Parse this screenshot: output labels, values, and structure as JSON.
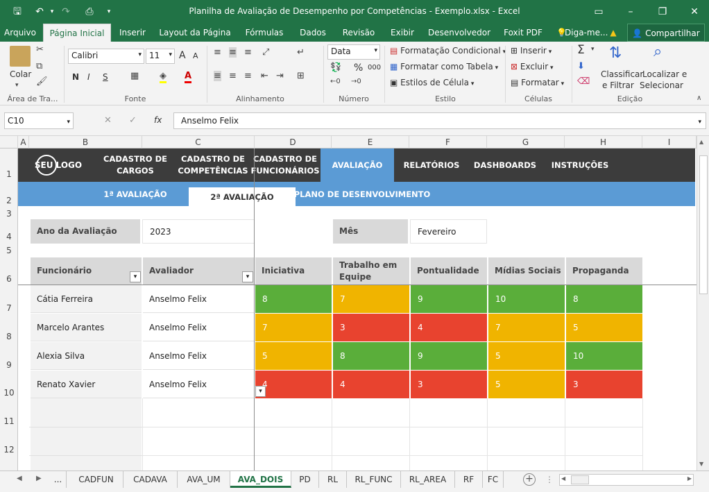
{
  "title": "Planilha de Avaliação de Desempenho por Competências - Exemplo.xlsx - Excel",
  "ribbon_tabs": [
    "Arquivo",
    "Página Inicial",
    "Inserir",
    "Layout da Página",
    "Fórmulas",
    "Dados",
    "Revisão",
    "Exibir",
    "Desenvolvedor",
    "Foxit PDF",
    "Diga-me...",
    "Compartilhar"
  ],
  "ribbon": {
    "clipboard": {
      "paste": "Colar",
      "label": "Área de Tra..."
    },
    "font": {
      "name": "Calibri",
      "size": "11",
      "bold": "N",
      "italic": "I",
      "underline": "S",
      "grow": "A",
      "shrink": "A",
      "label": "Fonte"
    },
    "alignment": {
      "label": "Alinhamento"
    },
    "number": {
      "format": "Data",
      "percent": "%",
      "thousands": "000",
      "label": "Número"
    },
    "styles": {
      "conditional": "Formatação Condicional",
      "table": "Formatar como Tabela",
      "cell": "Estilos de Célula",
      "label": "Estilo"
    },
    "cells": {
      "insert": "Inserir",
      "delete": "Excluir",
      "format": "Formatar",
      "label": "Células"
    },
    "editing": {
      "sum": "Σ",
      "sort1": "Classificar",
      "sort2": "e Filtrar",
      "find1": "Localizar e",
      "find2": "Selecionar",
      "label": "Edição"
    }
  },
  "formula_bar": {
    "name_box": "C10",
    "fx": "fx",
    "value": "Anselmo Felix"
  },
  "columns": [
    "A",
    "B",
    "C",
    "D",
    "E",
    "F",
    "G",
    "H",
    "I"
  ],
  "rows": [
    "1",
    "2",
    "3",
    "4",
    "5",
    "6",
    "7",
    "8",
    "9",
    "10",
    "11",
    "12"
  ],
  "nav": {
    "logo": "SEU LOGO",
    "items": [
      "CADASTRO DE\nCARGOS",
      "CADASTRO DE\nCOMPETÊNCIAS",
      "CADASTRO DE\nFUNCIONÁRIOS",
      "AVALIAÇÃO",
      "RELATÓRIOS",
      "DASHBOARDS",
      "INSTRUÇÕES"
    ]
  },
  "subnav": [
    "1ª AVALIAÇÃO",
    "2ª AVALIAÇÃO",
    "PLANO DE DESENVOLVIMENTO"
  ],
  "form": {
    "year_label": "Ano da Avaliação",
    "year_value": "2023",
    "month_label": "Mês",
    "month_value": "Fevereiro"
  },
  "table": {
    "headers": [
      "Funcionário",
      "Avaliador",
      "Iniciativa",
      "Trabalho em\nEquipe",
      "Pontualidade",
      "Mídias Sociais",
      "Propaganda"
    ],
    "rows": [
      {
        "employee": "Cátia Ferreira",
        "evaluator": "Anselmo Felix",
        "scores": [
          "8",
          "7",
          "9",
          "10",
          "8"
        ],
        "colors": [
          "green",
          "amber",
          "green",
          "green",
          "green"
        ]
      },
      {
        "employee": "Marcelo Arantes",
        "evaluator": "Anselmo Felix",
        "scores": [
          "7",
          "3",
          "4",
          "7",
          "5"
        ],
        "colors": [
          "amber",
          "red",
          "red",
          "amber",
          "amber"
        ]
      },
      {
        "employee": "Alexia Silva",
        "evaluator": "Anselmo Felix",
        "scores": [
          "5",
          "8",
          "9",
          "5",
          "10"
        ],
        "colors": [
          "amber",
          "green",
          "green",
          "amber",
          "green"
        ]
      },
      {
        "employee": "Renato Xavier",
        "evaluator": "Anselmo Felix",
        "scores": [
          "4",
          "4",
          "3",
          "5",
          "3"
        ],
        "colors": [
          "red",
          "red",
          "red",
          "amber",
          "red"
        ]
      }
    ]
  },
  "score_colors": {
    "green": "#5aae3a",
    "amber": "#f0b400",
    "red": "#e8432f"
  },
  "theme": {
    "excel_green": "#217346",
    "nav_dark": "#3c3c3c",
    "nav_blue": "#5b9bd5",
    "header_gray": "#d9d9d9"
  },
  "sheets": [
    "...",
    "CADFUN",
    "CADAVA",
    "AVA_UM",
    "AVA_DOIS",
    "PD",
    "RL",
    "RL_FUNC",
    "RL_AREA",
    "RF",
    "FC"
  ],
  "active_sheet": "AVA_DOIS"
}
